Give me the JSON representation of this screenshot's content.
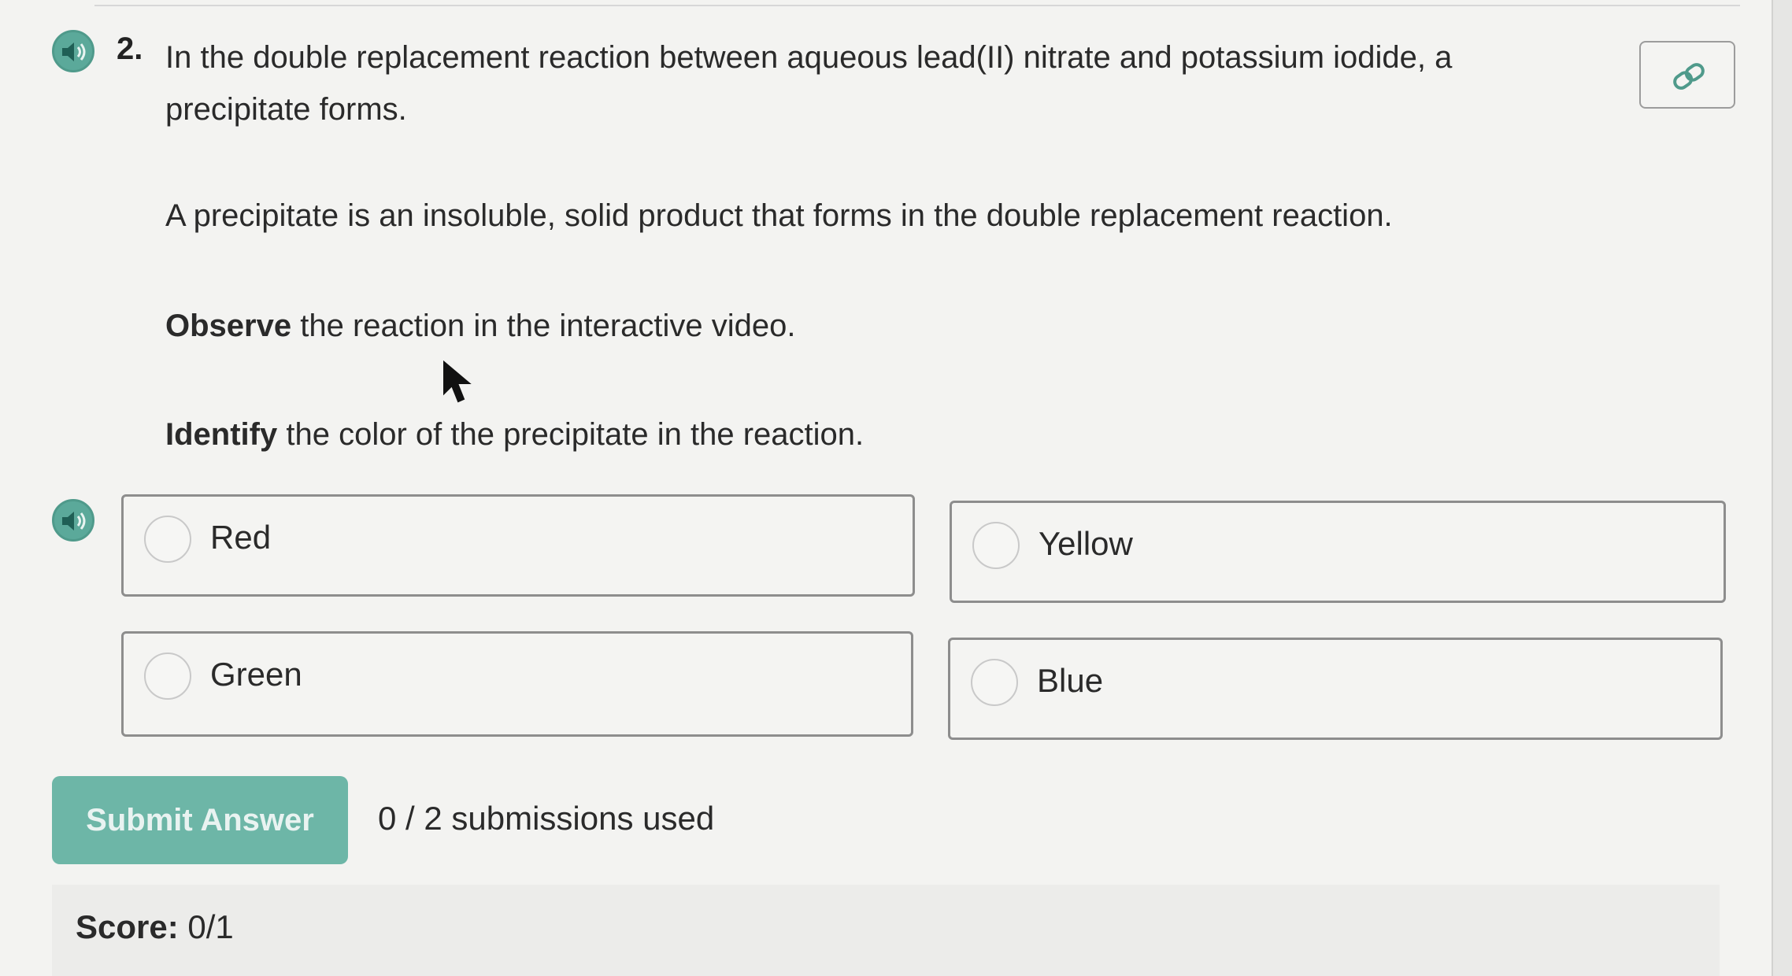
{
  "question": {
    "number": "2.",
    "text": "In the double replacement reaction between aqueous lead(II) nitrate and potassium iodide, a precipitate forms.",
    "definition": "A precipitate is an insoluble, solid product that forms in the double replacement reaction.",
    "observe_bold": "Observe",
    "observe_rest": " the reaction in the interactive video.",
    "identify_bold": "Identify",
    "identify_rest": " the color of the precipitate in the reaction."
  },
  "options": [
    {
      "label": "Red"
    },
    {
      "label": "Yellow"
    },
    {
      "label": "Green"
    },
    {
      "label": "Blue"
    }
  ],
  "submit": {
    "label": "Submit Answer",
    "submissions_used": "0 / 2 submissions used"
  },
  "score": {
    "label": "Score:",
    "value": "0/1"
  },
  "icons": {
    "question_audio": "speaker-icon",
    "options_audio": "speaker-icon",
    "link": "link-icon",
    "cursor": "mouse-pointer-icon"
  },
  "colors": {
    "accent": "#5ba99a",
    "submit_button": "#6db6a7",
    "background": "#f3f3f1"
  }
}
